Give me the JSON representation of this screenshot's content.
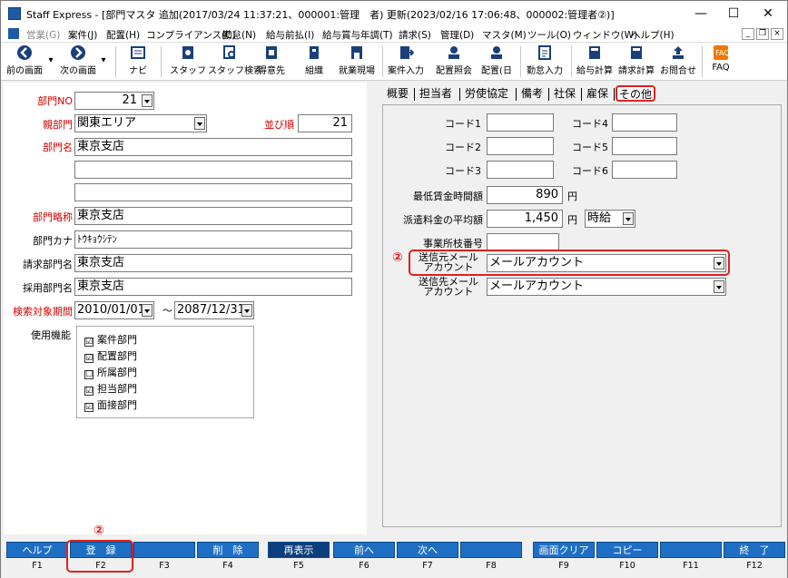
{
  "window": {
    "title": "Staff Express - [部門マスタ 追加(2017/03/24 11:37:21、000001:管理　者) 更新(2023/02/16 17:06:48、000002:管理者②)]"
  },
  "menubar": {
    "items": [
      "営業(G)",
      "案件(J)",
      "配置(H)",
      "コンプライアンス(C)",
      "勤怠(N)",
      "給与前払(I)",
      "給与賞与年調(T)",
      "請求(S)",
      "管理(D)",
      "マスタ(M)",
      "ツール(O)",
      "ウィンドウ(W)",
      "ヘルプ(H)"
    ]
  },
  "toolbar": {
    "prev": "前の画面",
    "next": "次の画面",
    "navi": "ナビ",
    "staff": "スタッフ",
    "staff_search": "スタッフ検索",
    "customer": "得意先",
    "org": "組織",
    "site": "就業現場",
    "case_entry": "案件入力",
    "assign_inquiry": "配置照会",
    "assign_day": "配置(日",
    "attendance_entry": "勤怠入力",
    "pay_calc": "給与計算",
    "bill_calc": "請求計算",
    "inquiry": "お問合せ",
    "faq": "FAQ"
  },
  "form": {
    "dept_no_label": "部門NO",
    "dept_no": "21",
    "parent_label": "親部門",
    "parent": "関東エリア",
    "order_label": "並び順",
    "order": "21",
    "name_label": "部門名",
    "name1": "東京支店",
    "name2": "",
    "name3": "",
    "short_label": "部門略称",
    "short": "東京支店",
    "kana_label": "部門カナ",
    "kana": "ﾄｳｷｮｳｼﾃﾝ",
    "billing_label": "請求部門名",
    "billing": "東京支店",
    "hiring_label": "採用部門名",
    "hiring": "東京支店",
    "period_label": "検索対象期間",
    "period_from": "2010/01/01",
    "tilde": "～",
    "period_to": "2087/12/31",
    "features_label": "使用機能",
    "features": [
      {
        "label": "案件部門",
        "checked": "☑"
      },
      {
        "label": "配置部門",
        "checked": "☑"
      },
      {
        "label": "所属部門",
        "checked": "☐"
      },
      {
        "label": "担当部門",
        "checked": "☑"
      },
      {
        "label": "面接部門",
        "checked": "☑"
      }
    ]
  },
  "tabs": [
    "概要",
    "担当者",
    "労使協定",
    "備考",
    "社保",
    "雇保",
    "その他"
  ],
  "other": {
    "code1": "コード1",
    "code2": "コード2",
    "code3": "コード3",
    "code4": "コード4",
    "code5": "コード5",
    "code6": "コード6",
    "min_wage_label": "最低賃金時間額",
    "min_wage": "890",
    "yen": "円",
    "avg_fee_label": "派遣料金の平均額",
    "avg_fee": "1,450",
    "avg_unit": "時給",
    "branch_label": "事業所枝番号",
    "branch": "",
    "sender_label": "送信元メール\nアカウント",
    "sender": "メールアカウント",
    "dest_label": "送信先メール\nアカウント",
    "dest": "メールアカウント"
  },
  "marker": "②",
  "fkeys": [
    {
      "label": "ヘルプ",
      "key": "F1"
    },
    {
      "label": "登　録",
      "key": "F2"
    },
    {
      "label": "",
      "key": "F3"
    },
    {
      "label": "削　除",
      "key": "F4"
    },
    {
      "label": "再表示",
      "key": "F5"
    },
    {
      "label": "前へ",
      "key": "F6"
    },
    {
      "label": "次へ",
      "key": "F7"
    },
    {
      "label": "",
      "key": "F8"
    },
    {
      "label": "画面クリア",
      "key": "F9"
    },
    {
      "label": "コピー",
      "key": "F10"
    },
    {
      "label": "",
      "key": "F11"
    },
    {
      "label": "終　了",
      "key": "F12"
    }
  ],
  "colors": {
    "accent": "#1e6fc4",
    "required": "#d40000",
    "highlight": "#e02020"
  }
}
